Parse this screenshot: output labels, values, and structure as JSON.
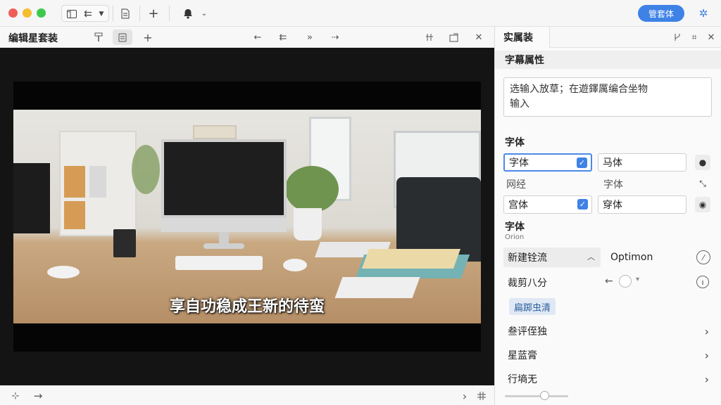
{
  "toolbar": {
    "sidebar_toggle_icon": "sidebar-icon",
    "nav_icon": "back-forward-icon",
    "dropdown_icon": "chevron-down-icon",
    "document_icon": "document-icon",
    "add_label": "+",
    "bell_icon": "bell-icon",
    "bell_dropdown_icon": "chevron-down-icon",
    "primary_button_label": "管套体",
    "primary_color": "#3f82e6",
    "settings_icon": "gear-icon"
  },
  "editor": {
    "title": "编辑星套装",
    "header_icons": [
      "format-painter-icon",
      "document-icon",
      "plus-icon",
      "arrow-left-icon",
      "double-arrow-left-icon",
      "double-arrow-right-icon",
      "arrow-right-dashed-icon",
      "split-icon",
      "export-icon",
      "close-icon"
    ],
    "add_label": "+",
    "close_label": "✕",
    "subtitle": "享自功稳成王新的待蛮",
    "footer_left_icon": "plus-icon",
    "footer_arrow_icon": "arrow-right-icon",
    "footer_right_chevron": "›",
    "footer_right_icon": "columns-icon"
  },
  "panel": {
    "tab_label": "实属装",
    "header_icons": [
      "branch-icon",
      "grid-icon",
      "close-icon"
    ],
    "section_title": "字幕属性",
    "text_value": "选输入放草；在遊鐸厲编合坐物\n输入",
    "font_section_label": "字体",
    "font_fields": [
      {
        "value": "字体",
        "checked": true
      },
      {
        "value": "马体",
        "checked": false
      }
    ],
    "font_row_labels": [
      "网经",
      "字体"
    ],
    "font_fields_2": [
      {
        "value": "宫体",
        "checked": true
      },
      {
        "value": "穿体",
        "checked": false
      }
    ],
    "font_label_2": "字体",
    "font_sublabel": "Orion",
    "dropdown_value": "新建铨流",
    "dropdown_side_value": "Optimon",
    "spacing_label": "裁剪八分",
    "chip_label": "扁踯虫清",
    "rows": [
      "叁评侄独",
      "星蓝膏",
      "行墒无"
    ]
  }
}
